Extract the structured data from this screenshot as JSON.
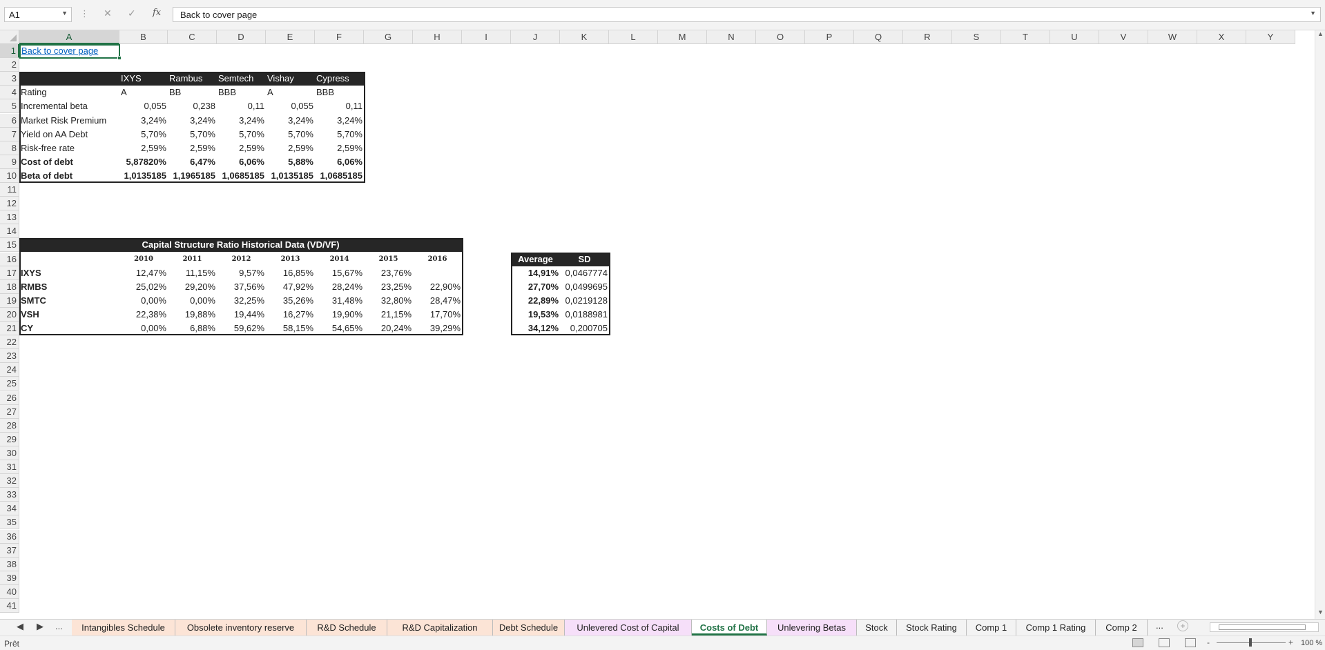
{
  "formula_bar": {
    "name_box": "A1",
    "cancel_icon": "✕",
    "enter_icon": "✓",
    "fx_label": "fx",
    "content": "Back to cover page"
  },
  "columns": [
    "A",
    "B",
    "C",
    "D",
    "E",
    "F",
    "G",
    "H",
    "I",
    "J",
    "K",
    "L",
    "M",
    "N",
    "O",
    "P",
    "Q",
    "R",
    "S",
    "T",
    "U",
    "V",
    "W",
    "X",
    "Y"
  ],
  "rows": [
    "1",
    "2",
    "3",
    "4",
    "5",
    "6",
    "7",
    "8",
    "9",
    "10",
    "11",
    "12",
    "13",
    "14",
    "15",
    "16",
    "17",
    "18",
    "19",
    "20",
    "21",
    "22",
    "23",
    "24",
    "25",
    "26",
    "27",
    "28",
    "29",
    "30",
    "31",
    "32",
    "33",
    "34",
    "35",
    "36",
    "37",
    "38",
    "39",
    "40",
    "41"
  ],
  "link_cell": "Back to cover page",
  "debt_table": {
    "companies": [
      "IXYS",
      "Rambus",
      "Semtech",
      "Vishay",
      "Cypress"
    ],
    "rows": [
      {
        "label": "Rating",
        "values": [
          "A",
          "BB",
          "BBB",
          "A",
          "BBB"
        ]
      },
      {
        "label": "Incremental beta",
        "values": [
          "0,055",
          "0,238",
          "0,11",
          "0,055",
          "0,11"
        ]
      },
      {
        "label": "Market Risk Premium",
        "values": [
          "3,24%",
          "3,24%",
          "3,24%",
          "3,24%",
          "3,24%"
        ]
      },
      {
        "label": "Yield on AA Debt",
        "values": [
          "5,70%",
          "5,70%",
          "5,70%",
          "5,70%",
          "5,70%"
        ]
      },
      {
        "label": "Risk-free rate",
        "values": [
          "2,59%",
          "2,59%",
          "2,59%",
          "2,59%",
          "2,59%"
        ]
      },
      {
        "label": "Cost of debt",
        "values": [
          "5,87820%",
          "6,47%",
          "6,06%",
          "5,88%",
          "6,06%"
        ]
      },
      {
        "label": "Beta of debt",
        "values": [
          "1,0135185",
          "1,1965185",
          "1,0685185",
          "1,0135185",
          "1,0685185"
        ]
      }
    ]
  },
  "capital_table": {
    "title": "Capital Structure Ratio Historical Data (VD/VF)",
    "years": [
      "2010",
      "2011",
      "2012",
      "2013",
      "2014",
      "2015",
      "2016"
    ],
    "rows": [
      {
        "label": "IXYS",
        "values": [
          "12,47%",
          "11,15%",
          "9,57%",
          "16,85%",
          "15,67%",
          "23,76%",
          ""
        ]
      },
      {
        "label": "RMBS",
        "values": [
          "25,02%",
          "29,20%",
          "37,56%",
          "47,92%",
          "28,24%",
          "23,25%",
          "22,90%"
        ]
      },
      {
        "label": "SMTC",
        "values": [
          "0,00%",
          "0,00%",
          "32,25%",
          "35,26%",
          "31,48%",
          "32,80%",
          "28,47%"
        ]
      },
      {
        "label": "VSH",
        "values": [
          "22,38%",
          "19,88%",
          "19,44%",
          "16,27%",
          "19,90%",
          "21,15%",
          "17,70%"
        ]
      },
      {
        "label": "CY",
        "values": [
          "0,00%",
          "6,88%",
          "59,62%",
          "58,15%",
          "54,65%",
          "20,24%",
          "39,29%"
        ]
      }
    ]
  },
  "stats_table": {
    "headers": [
      "Average",
      "SD"
    ],
    "rows": [
      [
        "14,91%",
        "0,0467774"
      ],
      [
        "27,70%",
        "0,0499695"
      ],
      [
        "22,89%",
        "0,0219128"
      ],
      [
        "19,53%",
        "0,0188981"
      ],
      [
        "34,12%",
        "0,200705"
      ]
    ]
  },
  "tabs": {
    "nav_prev": "◀",
    "nav_next": "▶",
    "nav_more": "...",
    "items": [
      {
        "label": "Intangibles Schedule",
        "color": "peach"
      },
      {
        "label": "Obsolete inventory reserve",
        "color": "peach"
      },
      {
        "label": "R&D Schedule",
        "color": "peach"
      },
      {
        "label": "R&D Capitalization",
        "color": "peach"
      },
      {
        "label": "Debt Schedule",
        "color": "peach"
      },
      {
        "label": "Unlevered Cost of Capital",
        "color": "pink"
      },
      {
        "label": "Costs of Debt",
        "color": "active"
      },
      {
        "label": "Unlevering Betas",
        "color": "pink"
      },
      {
        "label": "Stock",
        "color": "plain"
      },
      {
        "label": "Stock Rating",
        "color": "plain"
      },
      {
        "label": "Comp 1",
        "color": "plain"
      },
      {
        "label": "Comp 1 Rating",
        "color": "plain"
      },
      {
        "label": "Comp 2",
        "color": "plain"
      }
    ],
    "more": "...",
    "add": "+"
  },
  "status": {
    "text": "Prêt",
    "zoom_minus": "-",
    "zoom_plus": "+",
    "zoom": "100 %"
  }
}
